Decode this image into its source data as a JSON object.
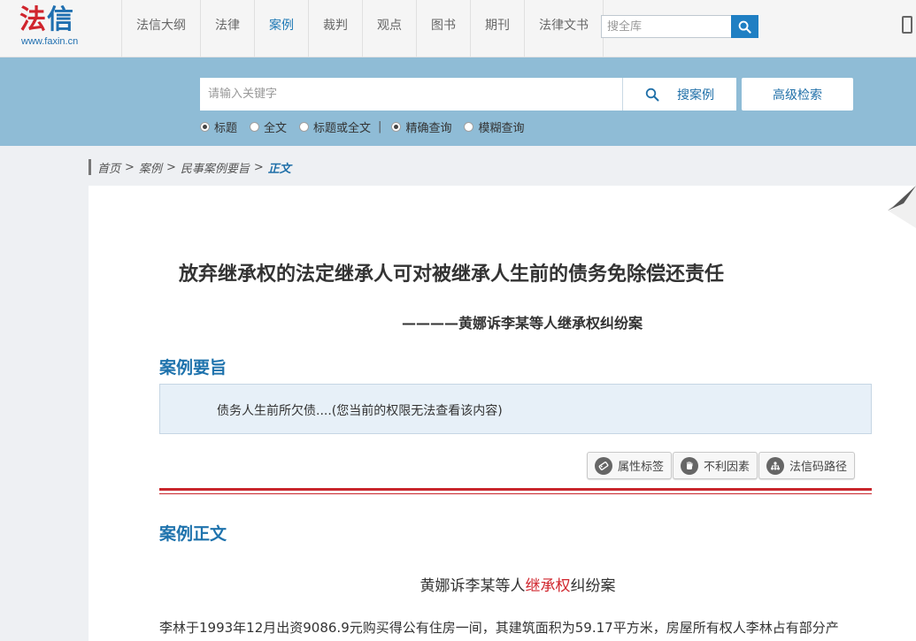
{
  "logo": {
    "part1": "法",
    "part2": "信",
    "url": "www.faxin.cn"
  },
  "nav": {
    "items": [
      "法信大纲",
      "法律",
      "案例",
      "裁判",
      "观点",
      "图书",
      "期刊",
      "法律文书"
    ],
    "active_index": 2
  },
  "top_search": {
    "placeholder": "搜全库"
  },
  "search": {
    "placeholder": "请输入关键字",
    "search_case_label": "搜案例",
    "advanced_label": "高级检索",
    "options": {
      "title": "标题",
      "fulltext": "全文",
      "title_or_fulltext": "标题或全文",
      "separator": "|",
      "exact": "精确查询",
      "fuzzy": "模糊查询"
    },
    "selected": [
      "标题",
      "精确查询"
    ]
  },
  "breadcrumb": {
    "home": "首页",
    "cases": "案例",
    "category": "民事案例要旨",
    "current": "正文",
    "sep": ">"
  },
  "article": {
    "title": "放弃继承权的法定继承人可对被继承人生前的债务免除偿还责任",
    "subtitle": "————黄娜诉李某等人继承权纠纷案",
    "gist_heading": "案例要旨",
    "gist_text": "债务人生前所欠债....(您当前的权限无法查看该内容)",
    "tags": [
      "属性标签",
      "不利因素",
      "法信码路径"
    ],
    "body_heading": "案例正文",
    "body_title_before": "黄娜诉李某等人",
    "body_title_highlight": "继承权",
    "body_title_after": "纠纷案",
    "body_first_line": "李林于1993年12月出资9086.9元购买得公有住房一间，其建筑面积为59.17平方米，房屋所有权人李林占有部分产"
  },
  "colors": {
    "brand_red": "#d0252d",
    "brand_blue": "#1f6fb0",
    "band": "#8fbcd6",
    "section_blue": "#1f73ad"
  }
}
